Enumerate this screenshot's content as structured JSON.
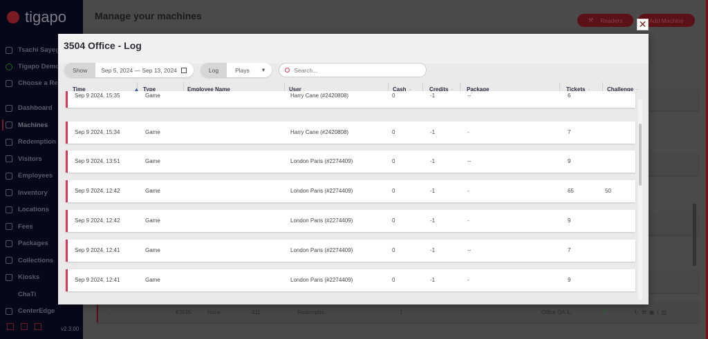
{
  "brand": {
    "name": "tigapo",
    "accent": "#d83a5a"
  },
  "sidebar": {
    "user": "Tsachi Sayeg",
    "org": "Tigapo Demo",
    "choose": "Choose a Res",
    "items": [
      {
        "label": "Dashboard"
      },
      {
        "label": "Machines",
        "active": true
      },
      {
        "label": "Redemption"
      },
      {
        "label": "Visitors"
      },
      {
        "label": "Employees"
      },
      {
        "label": "Inventory"
      },
      {
        "label": "Locations"
      },
      {
        "label": "Fees"
      },
      {
        "label": "Packages"
      },
      {
        "label": "Collections"
      },
      {
        "label": "Kiosks"
      },
      {
        "label": "ChaTi"
      },
      {
        "label": "CenterEdge"
      }
    ],
    "version": "v2.3.00"
  },
  "page": {
    "title": "Manage your machines",
    "readers_label": "Readers",
    "add_machine_label": "Add Machine"
  },
  "bg_row": {
    "col1": "...",
    "id": "63535",
    "type": "None",
    "num": "411",
    "kind": "Redemptio...",
    "qty": "1",
    "location": "Office QA IL"
  },
  "modal": {
    "title": "3504 Office - Log",
    "close": "✕",
    "show_label": "Show",
    "date_range": "Sep 5, 2024 — Sep 13, 2024",
    "log_label": "Log",
    "log_value": "Plays",
    "search_placeholder": "Search...",
    "columns": [
      "Time",
      "Type",
      "Employee Name",
      "User",
      "Cash",
      "Credits",
      "Package",
      "Tickets",
      "Challenge"
    ],
    "rows": [
      {
        "time": "Sep 9 2024, 15:35",
        "type": "Game",
        "employee": "",
        "user": "Harry Cane (#2420808)",
        "cash": "0",
        "credits": "-1",
        "package": "--",
        "tickets": "6",
        "challenge": ""
      },
      {
        "time": "Sep 9 2024, 15:34",
        "type": "Game",
        "employee": "",
        "user": "Harry Cane (#2420808)",
        "cash": "0",
        "credits": "-1",
        "package": "-",
        "tickets": "7",
        "challenge": ""
      },
      {
        "time": "Sep 9 2024, 13:51",
        "type": "Game",
        "employee": "",
        "user": "London Paris (#2274409)",
        "cash": "0",
        "credits": "-1",
        "package": "--",
        "tickets": "9",
        "challenge": ""
      },
      {
        "time": "Sep 9 2024, 12:42",
        "type": "Game",
        "employee": "",
        "user": "London Paris (#2274409)",
        "cash": "0",
        "credits": "-1",
        "package": "-",
        "tickets": "65",
        "challenge": "50"
      },
      {
        "time": "Sep 9 2024, 12:42",
        "type": "Game",
        "employee": "",
        "user": "London Paris (#2274409)",
        "cash": "0",
        "credits": "-1",
        "package": "-",
        "tickets": "9",
        "challenge": ""
      },
      {
        "time": "Sep 9 2024, 12:41",
        "type": "Game",
        "employee": "",
        "user": "London Paris (#2274409)",
        "cash": "0",
        "credits": "-1",
        "package": "--",
        "tickets": "7",
        "challenge": ""
      },
      {
        "time": "Sep 9 2024, 12:41",
        "type": "Game",
        "employee": "",
        "user": "London Paris (#2274409)",
        "cash": "0",
        "credits": "-1",
        "package": "-",
        "tickets": "9",
        "challenge": ""
      }
    ]
  }
}
